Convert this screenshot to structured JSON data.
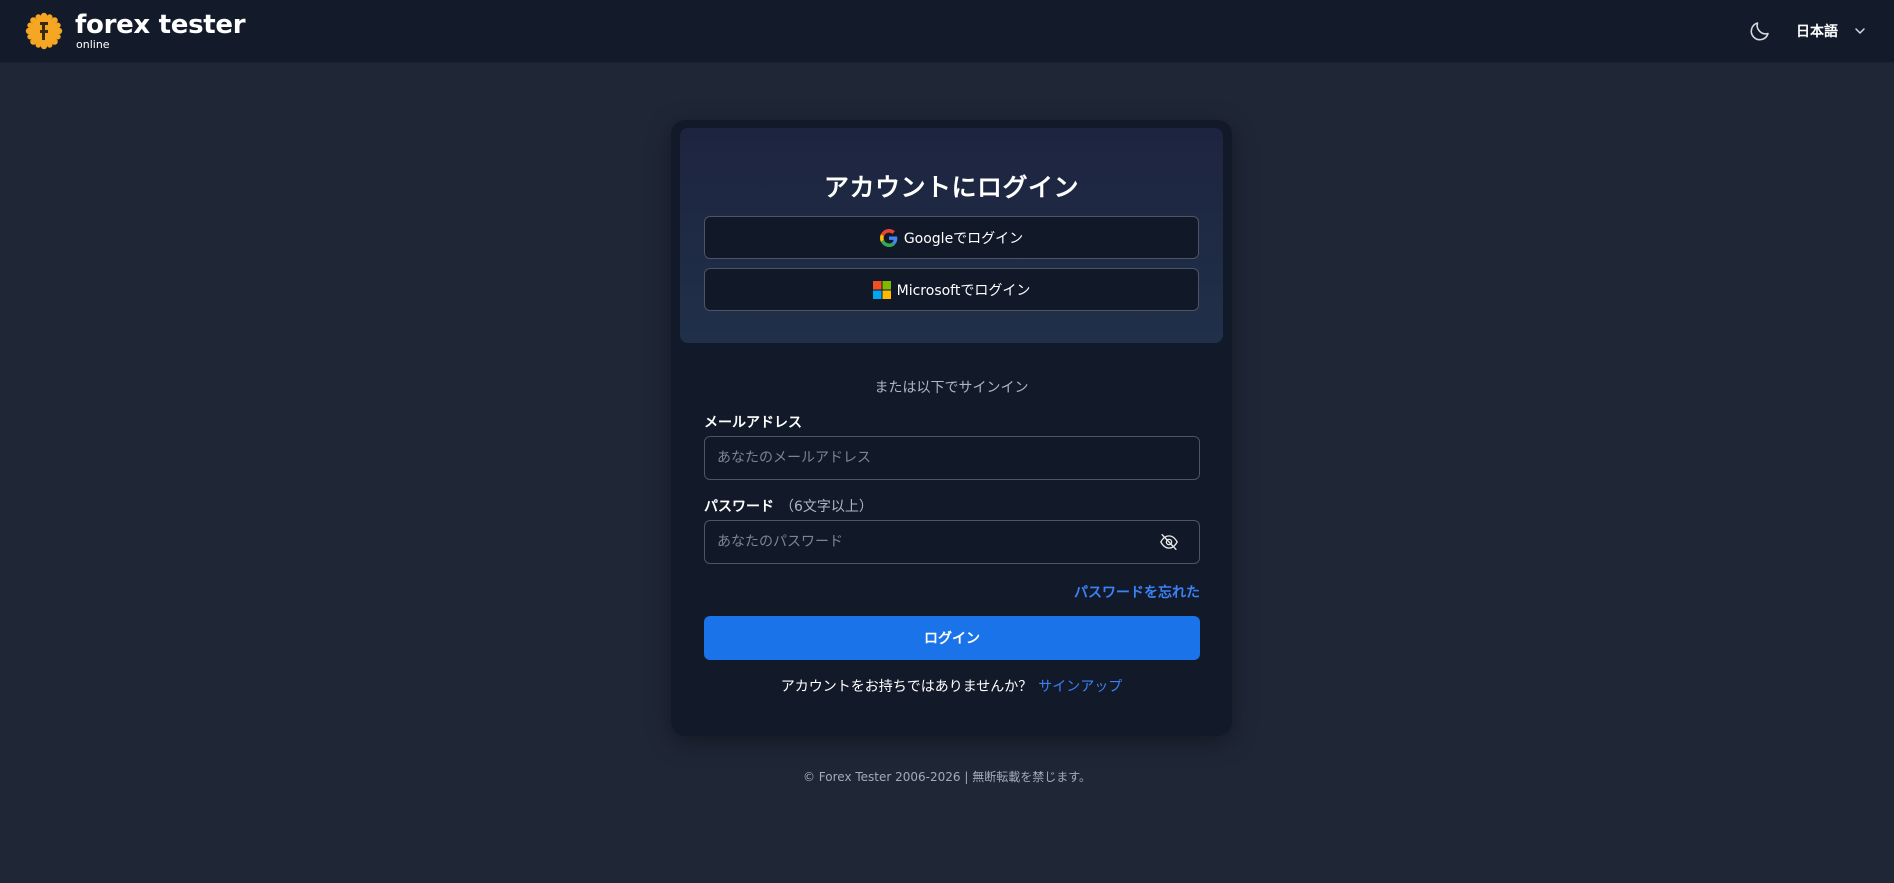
{
  "header": {
    "logo_name": "forex tester",
    "logo_sub": "online",
    "theme_icon": "moon-icon",
    "language": "日本語"
  },
  "card": {
    "title": "アカウントにログイン",
    "google_label": "Googleでログイン",
    "microsoft_label": "Microsoftでログイン",
    "divider": "または以下でサインイン",
    "email_label": "メールアドレス",
    "email_placeholder": "あなたのメールアドレス",
    "email_value": "",
    "password_label": "パスワード",
    "password_hint": "（6文字以上）",
    "password_placeholder": "あなたのパスワード",
    "password_value": "",
    "forgot": "パスワードを忘れた",
    "login": "ログイン",
    "no_account": "アカウントをお持ちではありませんか？",
    "signup": "サインアップ"
  },
  "footer": "© Forex Tester 2006-2026 | 無断転載を禁じます。",
  "colors": {
    "background": "#1f2636",
    "header": "#131a2a",
    "card": "#121929",
    "accent": "#1a73e8",
    "link": "#3b82f6",
    "logo": "#f5a623"
  }
}
